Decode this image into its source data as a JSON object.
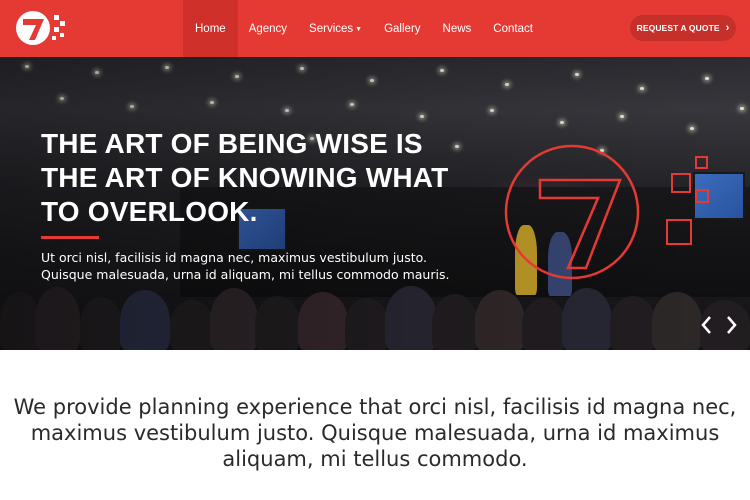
{
  "brand": {
    "logo_icon": "seven-logo-icon",
    "accent_color": "#e53a33"
  },
  "nav": {
    "items": [
      {
        "label": "Home",
        "active": true
      },
      {
        "label": "Agency",
        "active": false
      },
      {
        "label": "Services",
        "active": false,
        "has_dropdown": true
      },
      {
        "label": "Gallery",
        "active": false
      },
      {
        "label": "News",
        "active": false
      },
      {
        "label": "Contact",
        "active": false
      }
    ],
    "dropdown_icon": "chevron-down-icon"
  },
  "cta": {
    "label": "REQUEST A QUOTE",
    "icon": "chevron-right-icon"
  },
  "hero": {
    "title_lines": [
      "THE ART OF BEING WISE IS",
      "THE ART OF KNOWING WHAT",
      "TO OVERLOOK."
    ],
    "text_lines": [
      "Ut orci nisl, facilisis id magna nec, maximus vestibulum justo.",
      "Quisque malesuada, urna id aliquam, mi tellus commodo mauris."
    ],
    "prev_icon": "chevron-left-icon",
    "next_icon": "chevron-right-icon"
  },
  "intro": {
    "lines": [
      "We provide planning experience that orci nisl, facilisis id magna nec,",
      "maximus vestibulum justo. Quisque malesuada, urna id maximus",
      "aliquam, mi tellus commodo."
    ]
  }
}
